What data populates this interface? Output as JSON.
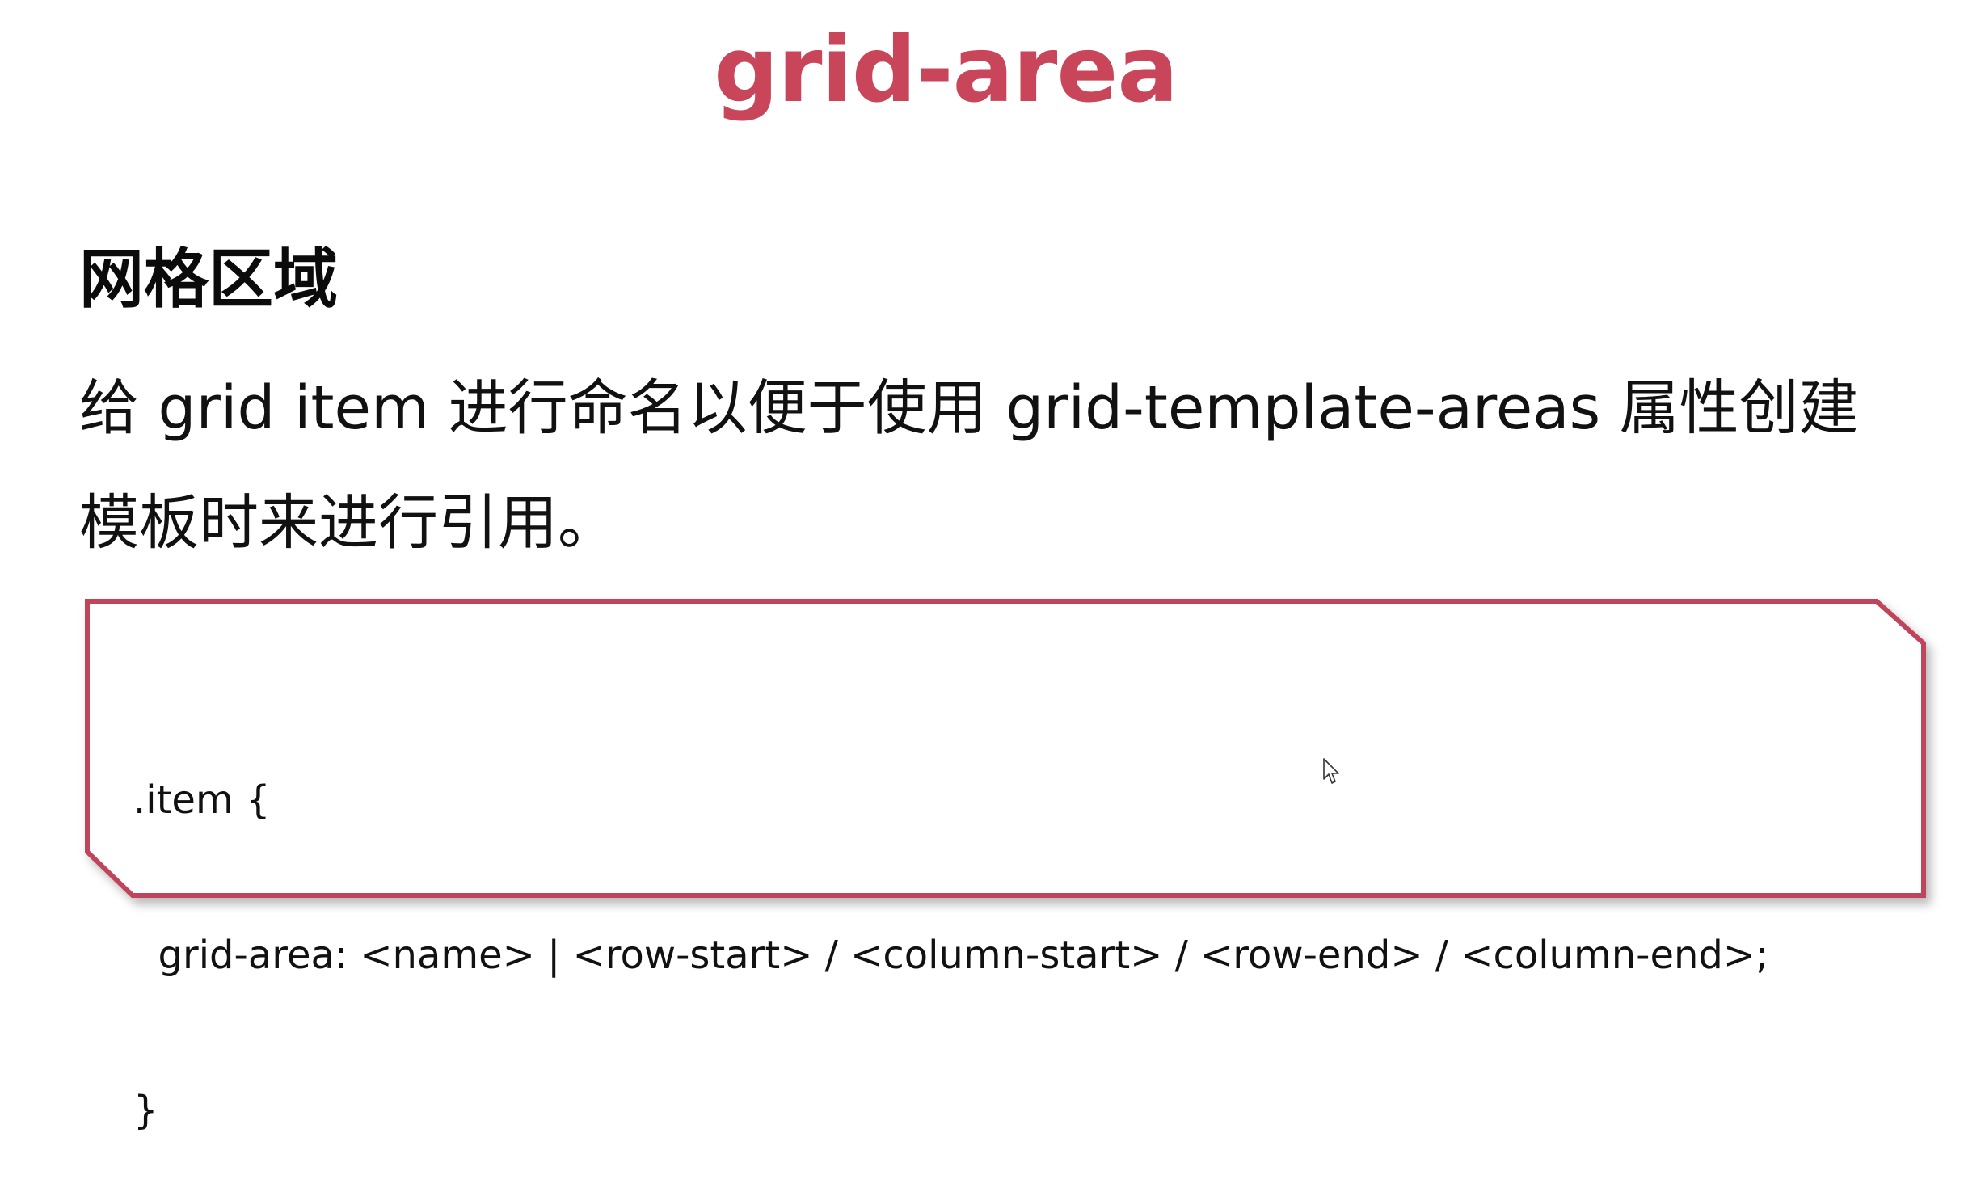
{
  "title": "grid-area",
  "heading": "网格区域",
  "description": {
    "line1": "给 grid item 进行命名以便于使用 grid-template-areas 属性创建",
    "line2": "模板时来进行引用。"
  },
  "code": {
    "line1": ".item {",
    "line2": "  grid-area: <name> | <row-start> / <column-start> / <row-end> / <column-end>;",
    "line3": "}"
  },
  "colors": {
    "accent": "#c8455a",
    "text": "#111111",
    "background": "#ffffff"
  },
  "icons": {
    "cursor": "mouse-pointer-icon"
  }
}
